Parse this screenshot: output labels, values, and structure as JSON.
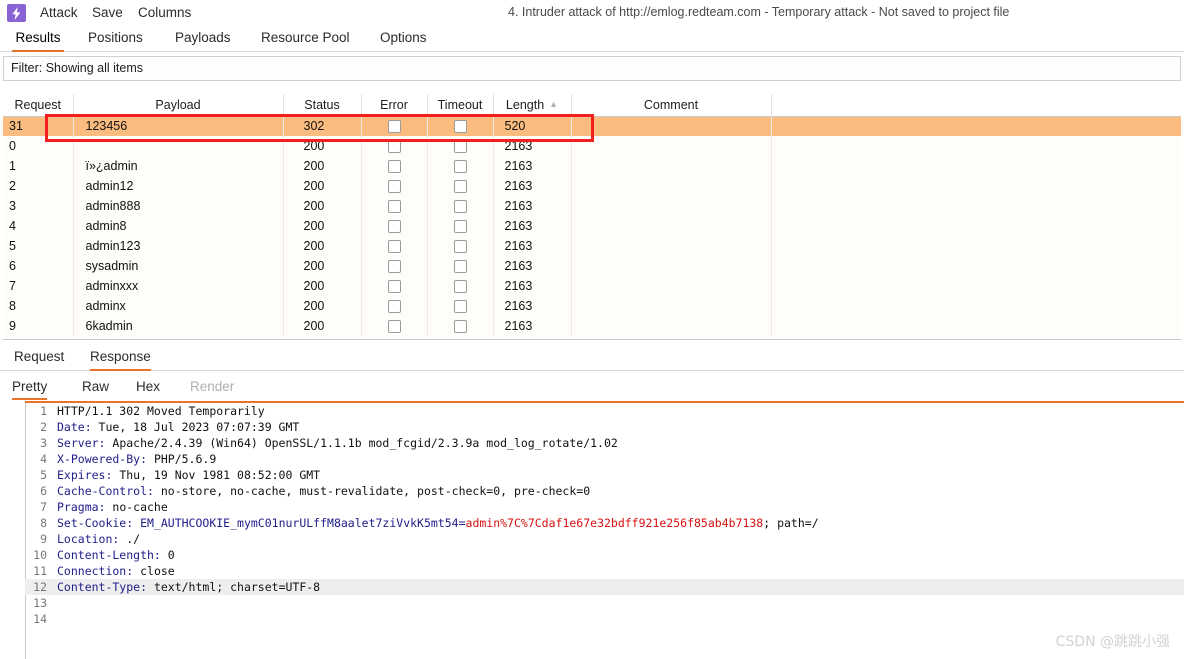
{
  "window": {
    "title": "4. Intruder attack of http://emlog.redteam.com - Temporary attack - Not saved to project file",
    "app_icon": "lightning-bolt-icon"
  },
  "menubar": {
    "items": [
      {
        "label": "Attack"
      },
      {
        "label": "Save"
      },
      {
        "label": "Columns"
      }
    ]
  },
  "tabs": [
    {
      "label": "Results",
      "active": true
    },
    {
      "label": "Positions",
      "active": false
    },
    {
      "label": "Payloads",
      "active": false
    },
    {
      "label": "Resource Pool",
      "active": false
    },
    {
      "label": "Options",
      "active": false
    }
  ],
  "filter": {
    "text": "Filter: Showing all items"
  },
  "results_table": {
    "columns": [
      "Request",
      "Payload",
      "Status",
      "Error",
      "Timeout",
      "Length",
      "Comment"
    ],
    "sorted_column": "Length",
    "sort_direction": "ascending",
    "sort_caret": "▲",
    "rows": [
      {
        "request": "31",
        "payload": "123456",
        "status": "302",
        "error": false,
        "timeout": false,
        "length": "520",
        "comment": "",
        "highlighted": true
      },
      {
        "request": "0",
        "payload": "",
        "status": "200",
        "error": false,
        "timeout": false,
        "length": "2163",
        "comment": "",
        "highlighted": false
      },
      {
        "request": "1",
        "payload": "ï»¿admin",
        "status": "200",
        "error": false,
        "timeout": false,
        "length": "2163",
        "comment": "",
        "highlighted": false
      },
      {
        "request": "2",
        "payload": "admin12",
        "status": "200",
        "error": false,
        "timeout": false,
        "length": "2163",
        "comment": "",
        "highlighted": false
      },
      {
        "request": "3",
        "payload": "admin888",
        "status": "200",
        "error": false,
        "timeout": false,
        "length": "2163",
        "comment": "",
        "highlighted": false
      },
      {
        "request": "4",
        "payload": "admin8",
        "status": "200",
        "error": false,
        "timeout": false,
        "length": "2163",
        "comment": "",
        "highlighted": false
      },
      {
        "request": "5",
        "payload": "admin123",
        "status": "200",
        "error": false,
        "timeout": false,
        "length": "2163",
        "comment": "",
        "highlighted": false
      },
      {
        "request": "6",
        "payload": "sysadmin",
        "status": "200",
        "error": false,
        "timeout": false,
        "length": "2163",
        "comment": "",
        "highlighted": false
      },
      {
        "request": "7",
        "payload": "adminxxx",
        "status": "200",
        "error": false,
        "timeout": false,
        "length": "2163",
        "comment": "",
        "highlighted": false
      },
      {
        "request": "8",
        "payload": "adminx",
        "status": "200",
        "error": false,
        "timeout": false,
        "length": "2163",
        "comment": "",
        "highlighted": false
      },
      {
        "request": "9",
        "payload": "6kadmin",
        "status": "200",
        "error": false,
        "timeout": false,
        "length": "2163",
        "comment": "",
        "highlighted": false
      }
    ],
    "highlight_color": "#fbbc7f",
    "annotation_color": "#f02020"
  },
  "message_tabs": [
    {
      "label": "Request",
      "active": false
    },
    {
      "label": "Response",
      "active": true
    }
  ],
  "view_tabs": [
    {
      "label": "Pretty",
      "active": true,
      "disabled": false
    },
    {
      "label": "Raw",
      "active": false,
      "disabled": false
    },
    {
      "label": "Hex",
      "active": false,
      "disabled": false
    },
    {
      "label": "Render",
      "active": false,
      "disabled": true
    }
  ],
  "response": {
    "lines": [
      {
        "n": "1",
        "type": "status",
        "text": "HTTP/1.1 302 Moved Temporarily"
      },
      {
        "n": "2",
        "type": "header",
        "key": "Date",
        "value": "Tue, 18 Jul 2023 07:07:39 GMT"
      },
      {
        "n": "3",
        "type": "header",
        "key": "Server",
        "value": "Apache/2.4.39 (Win64) OpenSSL/1.1.1b mod_fcgid/2.3.9a mod_log_rotate/1.02"
      },
      {
        "n": "4",
        "type": "header",
        "key": "X-Powered-By",
        "value": "PHP/5.6.9"
      },
      {
        "n": "5",
        "type": "header",
        "key": "Expires",
        "value": "Thu, 19 Nov 1981 08:52:00 GMT"
      },
      {
        "n": "6",
        "type": "header",
        "key": "Cache-Control",
        "value": "no-store, no-cache, must-revalidate, post-check=0, pre-check=0"
      },
      {
        "n": "7",
        "type": "header",
        "key": "Pragma",
        "value": "no-cache"
      },
      {
        "n": "8",
        "type": "cookie",
        "key": "Set-Cookie",
        "cookie_name": "EM_AUTHCOOKIE_mymC01nurULffM8aalet7ziVvkK5mt54",
        "cookie_value": "admin%7C%7Cdaf1e67e32bdff921e256f85ab4b7138",
        "cookie_suffix": "; path=/"
      },
      {
        "n": "9",
        "type": "header",
        "key": "Location",
        "value": "./"
      },
      {
        "n": "10",
        "type": "header",
        "key": "Content-Length",
        "value": "0"
      },
      {
        "n": "11",
        "type": "header",
        "key": "Connection",
        "value": "close"
      },
      {
        "n": "12",
        "type": "header",
        "key": "Content-Type",
        "value": "text/html; charset=UTF-8",
        "banded": true
      },
      {
        "n": "13",
        "type": "blank"
      },
      {
        "n": "14",
        "type": "blank"
      }
    ]
  },
  "watermark": {
    "text": "CSDN @跳跳小强"
  }
}
